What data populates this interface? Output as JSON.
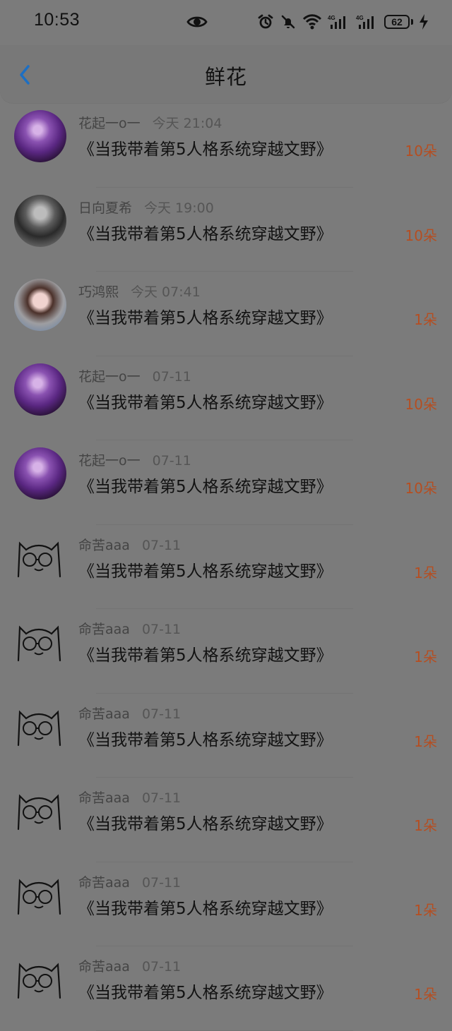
{
  "status_bar": {
    "time": "10:53",
    "battery": "62",
    "icons": [
      "eye-icon",
      "alarm-icon",
      "bell-off-icon",
      "wifi-icon",
      "signal-4g-1-icon",
      "signal-4g-2-icon",
      "battery-icon",
      "charging-icon"
    ]
  },
  "header": {
    "title": "鲜花",
    "back_icon": "chevron-left-icon"
  },
  "items": [
    {
      "user": "花起一o一",
      "time": "今天 21:04",
      "book": "《当我带着第5人格系统穿越文野》",
      "count": "10朵",
      "avatar": "purple"
    },
    {
      "user": "日向夏希",
      "time": "今天 19:00",
      "book": "《当我带着第5人格系统穿越文野》",
      "count": "10朵",
      "avatar": "dark"
    },
    {
      "user": "巧鸿熙",
      "time": "今天 07:41",
      "book": "《当我带着第5人格系统穿越文野》",
      "count": "1朵",
      "avatar": "girl"
    },
    {
      "user": "花起一o一",
      "time": "07-11",
      "book": "《当我带着第5人格系统穿越文野》",
      "count": "10朵",
      "avatar": "purple"
    },
    {
      "user": "花起一o一",
      "time": "07-11",
      "book": "《当我带着第5人格系统穿越文野》",
      "count": "10朵",
      "avatar": "purple"
    },
    {
      "user": "命苦aaa",
      "time": "07-11",
      "book": "《当我带着第5人格系统穿越文野》",
      "count": "1朵",
      "avatar": "line"
    },
    {
      "user": "命苦aaa",
      "time": "07-11",
      "book": "《当我带着第5人格系统穿越文野》",
      "count": "1朵",
      "avatar": "line"
    },
    {
      "user": "命苦aaa",
      "time": "07-11",
      "book": "《当我带着第5人格系统穿越文野》",
      "count": "1朵",
      "avatar": "line"
    },
    {
      "user": "命苦aaa",
      "time": "07-11",
      "book": "《当我带着第5人格系统穿越文野》",
      "count": "1朵",
      "avatar": "line"
    },
    {
      "user": "命苦aaa",
      "time": "07-11",
      "book": "《当我带着第5人格系统穿越文野》",
      "count": "1朵",
      "avatar": "line"
    },
    {
      "user": "命苦aaa",
      "time": "07-11",
      "book": "《当我带着第5人格系统穿越文野》",
      "count": "1朵",
      "avatar": "line"
    }
  ],
  "colors": {
    "overlay_background": "#7b7b7b",
    "text_primary": "#121212",
    "text_secondary": "#444444",
    "accent": "#b54e21",
    "back_icon": "#1d6fc3"
  }
}
